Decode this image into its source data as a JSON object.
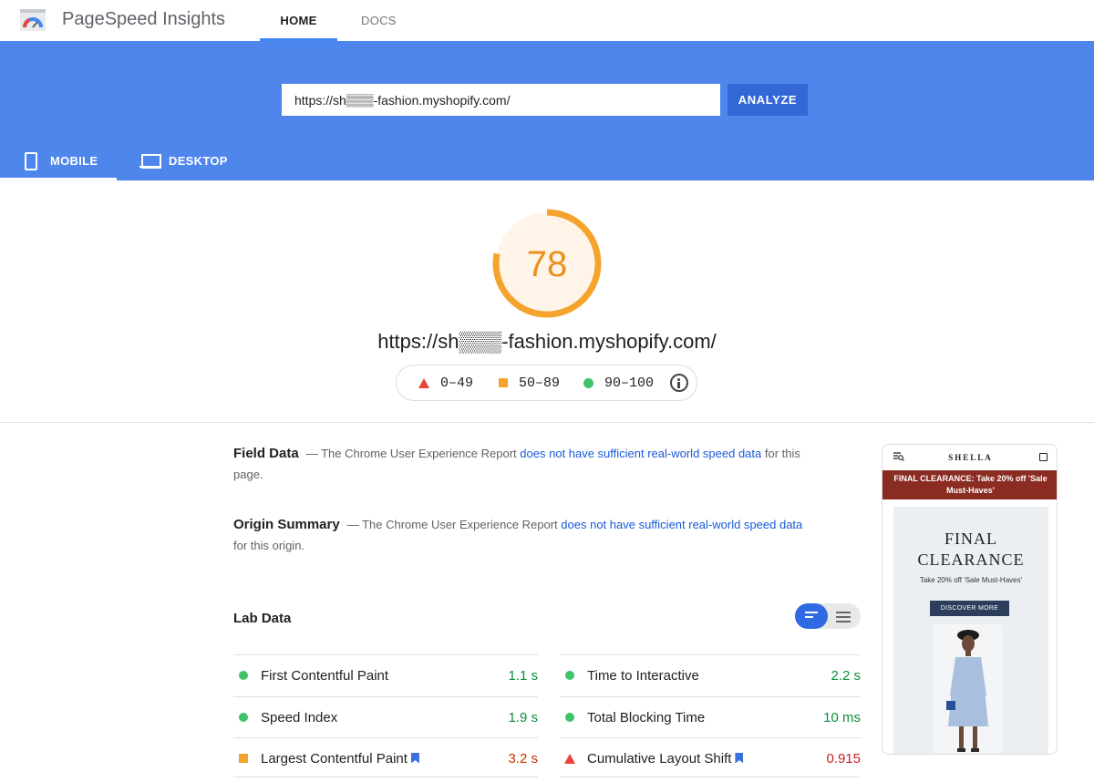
{
  "app": {
    "title": "PageSpeed Insights"
  },
  "nav": {
    "home": "HOME",
    "docs": "DOCS"
  },
  "search": {
    "url": "https://sh▒▒▒-fashion.myshopify.com/",
    "analyze": "ANALYZE"
  },
  "device_tabs": {
    "mobile": "MOBILE",
    "desktop": "DESKTOP",
    "selected": "mobile"
  },
  "score": {
    "value": "78",
    "fraction": 0.78,
    "url": "https://sh▒▒▒-fashion.myshopify.com/",
    "color": "#f4a42c"
  },
  "legend": {
    "poor": "0–49",
    "average": "50–89",
    "good": "90–100"
  },
  "field_data": {
    "title": "Field Data",
    "text_before": "— The Chrome User Experience Report ",
    "link": "does not have sufficient real-world speed data",
    "text_after": " for this page."
  },
  "origin_summary": {
    "title": "Origin Summary",
    "text_before": "— The Chrome User Experience Report ",
    "link": "does not have sufficient real-world speed data",
    "text_after": " for this origin."
  },
  "lab_data": {
    "title": "Lab Data",
    "metrics": [
      {
        "label": "First Contentful Paint",
        "value": "1.1 s",
        "status": "good"
      },
      {
        "label": "Time to Interactive",
        "value": "2.2 s",
        "status": "good"
      },
      {
        "label": "Speed Index",
        "value": "1.9 s",
        "status": "good"
      },
      {
        "label": "Total Blocking Time",
        "value": "10 ms",
        "status": "good"
      },
      {
        "label": "Largest Contentful Paint",
        "value": "3.2 s",
        "status": "average"
      },
      {
        "label": "Cumulative Layout Shift",
        "value": "0.915",
        "status": "poor"
      }
    ]
  },
  "screenshot": {
    "brand": "SHELLA",
    "promo": "FINAL CLEARANCE: Take 20% off 'Sale Must-Haves'",
    "hero_title_1": "FINAL",
    "hero_title_2": "CLEARANCE",
    "hero_sub": "Take 20% off 'Sale Must-Haves'",
    "button": "DISCOVER MORE"
  },
  "colors": {
    "accent_blue": "#4f86ec",
    "analyze_blue": "#3367d6",
    "good": "#3ec26a",
    "average": "#f4a42c",
    "poor": "#eb4335"
  }
}
